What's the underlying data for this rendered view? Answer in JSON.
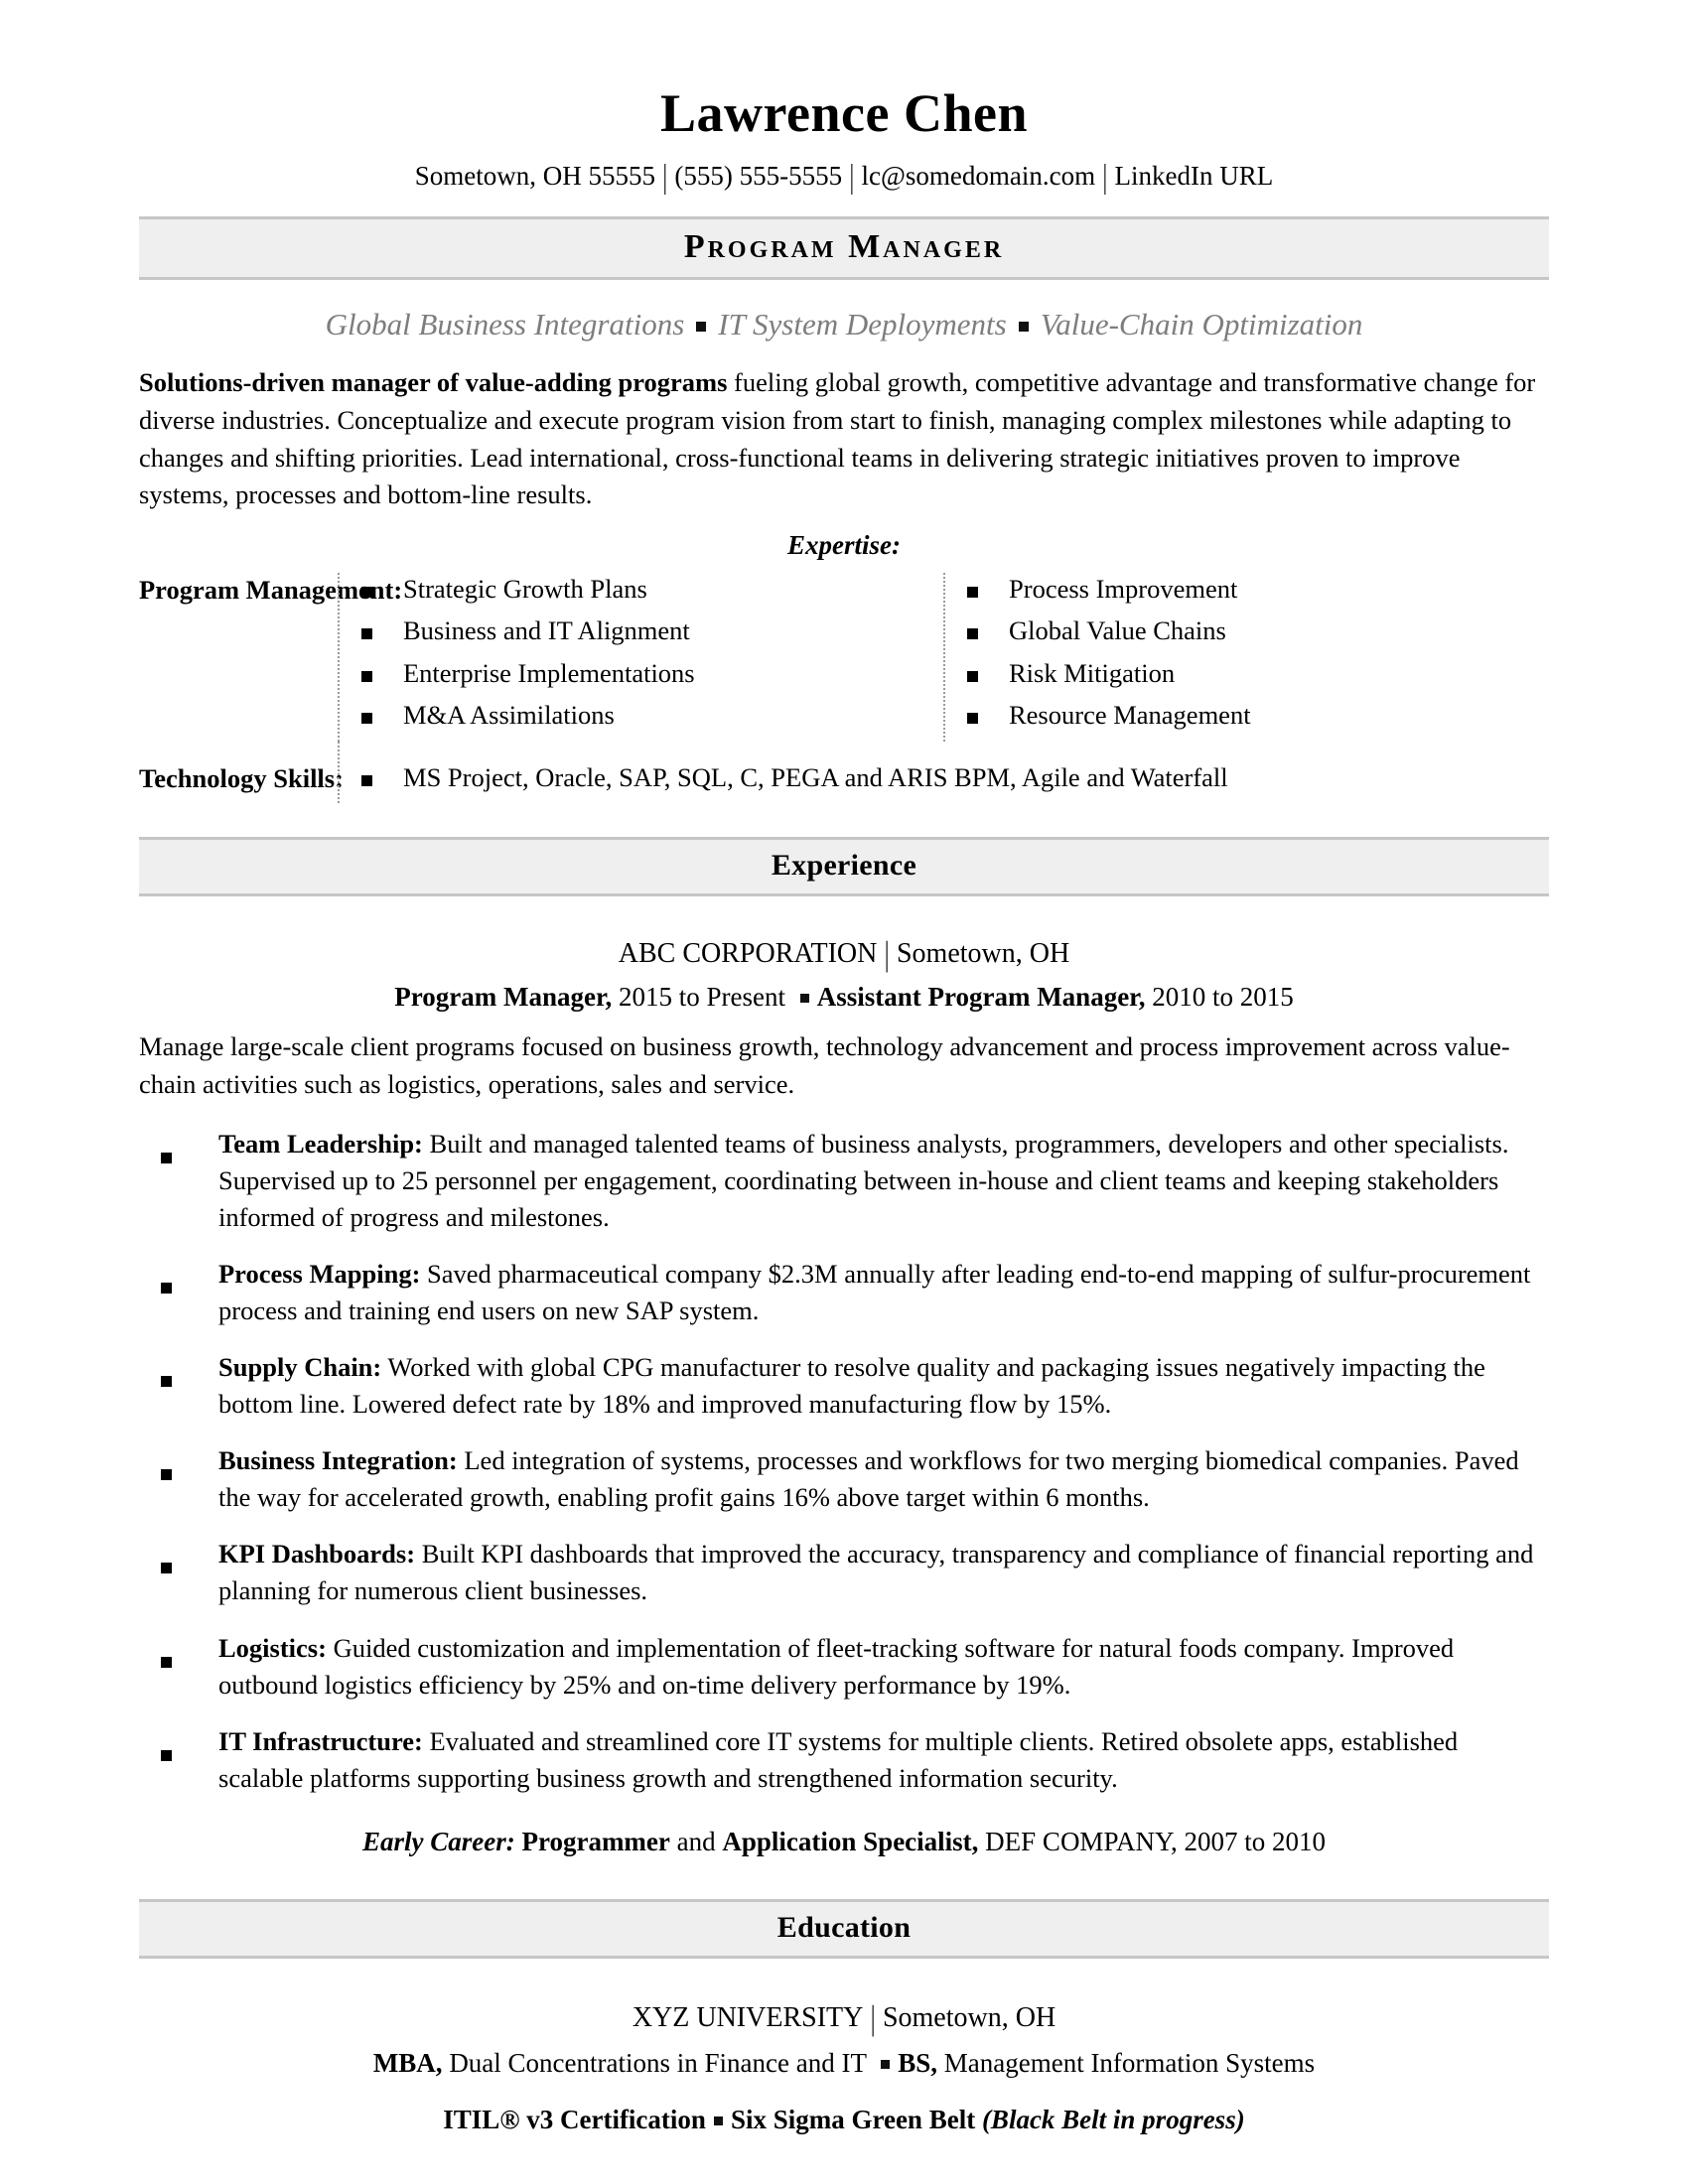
{
  "header": {
    "name": "Lawrence Chen",
    "contact": {
      "location": "Sometown, OH 55555",
      "phone": "(555) 555-5555",
      "email": "lc@somedomain.com",
      "linkedin": "LinkedIn URL",
      "separator": "|"
    }
  },
  "title_bar": {
    "title": "Program Manager"
  },
  "tagline": {
    "parts": [
      "Global Business Integrations",
      "IT System Deployments",
      "Value-Chain Optimization"
    ]
  },
  "summary": {
    "lead": "Solutions-driven manager of value-adding programs",
    "body": " fueling global growth, competitive advantage and transformative change for diverse industries. Conceptualize and execute program vision from start to finish, managing complex milestones while adapting to changes and shifting priorities. Lead international, cross-functional teams in delivering strategic initiatives proven to improve systems, processes and bottom-line results."
  },
  "expertise": {
    "heading": "Expertise:",
    "program_management_label": "Program Management:",
    "column_left": [
      "Strategic Growth Plans",
      "Business and IT Alignment",
      "Enterprise Implementations",
      "M&A Assimilations"
    ],
    "column_right": [
      "Process Improvement",
      "Global Value Chains",
      "Risk Mitigation",
      "Resource Management"
    ],
    "technology_label": "Technology Skills:",
    "technology_value": "MS Project, Oracle, SAP, SQL, C, PEGA and ARIS BPM, Agile and Waterfall"
  },
  "experience": {
    "section_title": "Experience",
    "company": "ABC CORPORATION",
    "company_separator": "|",
    "company_location": "Sometown, OH",
    "role_primary": "Program Manager,",
    "role_primary_dates": " 2015 to Present ",
    "role_secondary": "Assistant Program Manager,",
    "role_secondary_dates": " 2010 to 2015",
    "intro": "Manage large-scale client programs focused on business growth, technology advancement and process improvement across value-chain activities such as logistics, operations, sales and service.",
    "bullets": [
      {
        "label": "Team Leadership:",
        "text": " Built and managed talented teams of business analysts, programmers, developers and other specialists. Supervised up to 25 personnel per engagement, coordinating between in-house and client teams and keeping stakeholders informed of progress and milestones."
      },
      {
        "label": "Process Mapping:",
        "text": " Saved pharmaceutical company $2.3M annually after leading end-to-end mapping of sulfur-procurement process and training end users on new SAP system."
      },
      {
        "label": "Supply Chain:",
        "text": " Worked with global CPG manufacturer to resolve quality and packaging issues negatively impacting the bottom line. Lowered defect rate by 18% and improved manufacturing flow by 15%."
      },
      {
        "label": "Business Integration:",
        "text": " Led integration of systems, processes and workflows for two merging biomedical companies. Paved the way for accelerated growth, enabling profit gains 16% above target within 6 months."
      },
      {
        "label": "KPI Dashboards:",
        "text": " Built KPI dashboards that improved the accuracy, transparency and compliance of financial reporting and planning for numerous client businesses."
      },
      {
        "label": "Logistics:",
        "text": " Guided customization and implementation of fleet-tracking software for natural foods company. Improved outbound logistics efficiency by 25% and on-time delivery performance by 19%."
      },
      {
        "label": "IT Infrastructure:",
        "text": " Evaluated and streamlined core IT systems for multiple clients. Retired obsolete apps, established scalable platforms supporting business growth and strengthened information security."
      }
    ],
    "early_career": {
      "label": "Early Career:",
      "role_one": "Programmer",
      "conjunction": " and ",
      "role_two": "Application Specialist,",
      "detail": " DEF COMPANY, 2007 to 2010"
    }
  },
  "education": {
    "section_title": "Education",
    "school": "XYZ UNIVERSITY",
    "school_separator": "|",
    "school_location": "Sometown, OH",
    "degree_one_label": "MBA,",
    "degree_one_text": " Dual Concentrations in Finance and IT ",
    "degree_two_label": "BS,",
    "degree_two_text": " Management Information Systems",
    "certification_one": "ITIL® v3 Certification",
    "certification_two": "Six Sigma Green Belt",
    "certification_note": "(Black Belt in progress)"
  },
  "colors": {
    "section_bar_bg": "#efefef",
    "section_bar_border": "#c6c6c6",
    "tagline_gray": "#7d7d7d",
    "text": "#000000",
    "dotted_rule": "#9a9a9a"
  }
}
